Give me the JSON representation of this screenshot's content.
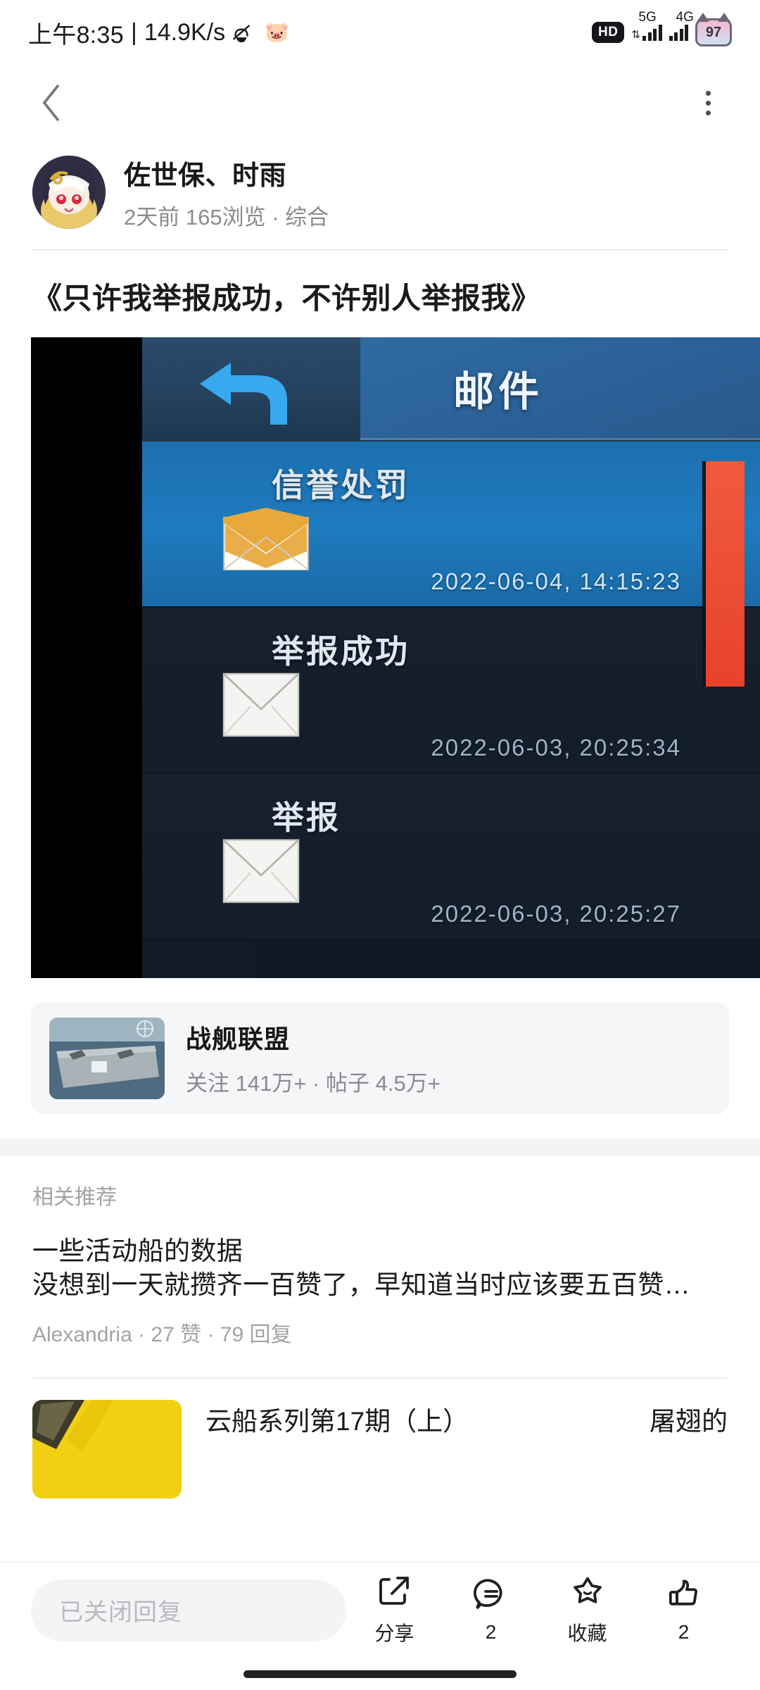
{
  "status_bar": {
    "time": "上午8:35",
    "separator": "|",
    "net_speed": "14.9K/s",
    "silent_icon": "bell-slash-icon",
    "emoji_icon": "pig-emoji-icon",
    "hd_label": "HD",
    "sim1_label": "5G",
    "sim2_label": "4G",
    "battery_percent": "97"
  },
  "navbar": {
    "back_icon": "back-chevron-icon",
    "more_icon": "more-vertical-icon"
  },
  "author": {
    "name": "佐世保、时雨",
    "meta": "2天前 165浏览 · 综合",
    "avatar_icon": "user-avatar"
  },
  "post": {
    "title": "《只许我举报成功，不许别人举报我》",
    "image": {
      "header_title": "邮件",
      "back_icon": "back-arrow-icon",
      "mails": [
        {
          "name": "信誉处罚",
          "date": "2022-06-04, 14:15:23",
          "selected": true,
          "envelope": "envelope-open-icon"
        },
        {
          "name": "举报成功",
          "date": "2022-06-03, 20:25:34",
          "selected": false,
          "envelope": "envelope-closed-icon"
        },
        {
          "name": "举报",
          "date": "2022-06-03, 20:25:27",
          "selected": false,
          "envelope": "envelope-closed-icon"
        }
      ]
    }
  },
  "forum": {
    "name": "战舰联盟",
    "stats": "关注 141万+ · 帖子 4.5万+",
    "thumb_icon": "aircraft-carrier-thumbnail"
  },
  "related": {
    "heading": "相关推荐",
    "items": [
      {
        "title": "一些活动船的数据",
        "snippet": "没想到一天就攒齐一百赞了，早知道当时应该要五百赞…",
        "meta": "Alexandria · 27 赞 · 79 回复"
      },
      {
        "title": "云船系列第17期（上）",
        "side_text": "屠翅的",
        "thumb_icon": "yellow-post-thumbnail"
      }
    ]
  },
  "bottom_bar": {
    "reply_placeholder": "已关闭回复",
    "actions": [
      {
        "label": "分享",
        "icon": "share-icon"
      },
      {
        "label": "2",
        "icon": "comment-icon"
      },
      {
        "label": "收藏",
        "icon": "star-icon"
      },
      {
        "label": "2",
        "icon": "thumbs-up-icon"
      }
    ]
  },
  "colors": {
    "accent_blue": "#1f7bc0",
    "red_strip": "#e8422c",
    "page_bg": "#ffffff",
    "muted_text": "#8a8a90"
  }
}
